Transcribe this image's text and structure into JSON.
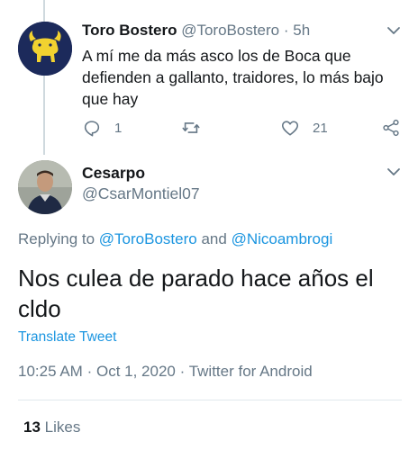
{
  "parent_tweet": {
    "author_name": "Toro Bostero",
    "author_handle": "@ToroBostero",
    "separator": "·",
    "time_ago": "5h",
    "text": "A mí me da más asco los de Boca que defienden a gallanto, traidores, lo más bajo que hay",
    "replies_count": "1",
    "likes_count": "21",
    "avatar_icon": "bull-logo-icon",
    "avatar_bg": "#1c2a5b",
    "avatar_fg": "#f2d230"
  },
  "reply_tweet": {
    "author_name": "Cesarpo",
    "author_handle": "@CsarMontiel07",
    "replying_prefix": "Replying to",
    "replying_to_1": "@ToroBostero",
    "replying_and": "and",
    "replying_to_2": "@Nicoambrogi",
    "text": "Nos culea de parado hace años el cldo",
    "translate_label": "Translate Tweet",
    "time": "10:25 AM",
    "date": "Oct 1, 2020",
    "source": "Twitter for Android",
    "separator": "·",
    "likes_count": "13",
    "likes_label": "Likes"
  },
  "colors": {
    "link": "#1b95e0",
    "secondary_text": "#657786",
    "primary_text": "#14171a",
    "divider": "#e1e8ed",
    "thread_line": "#cfd9de"
  }
}
